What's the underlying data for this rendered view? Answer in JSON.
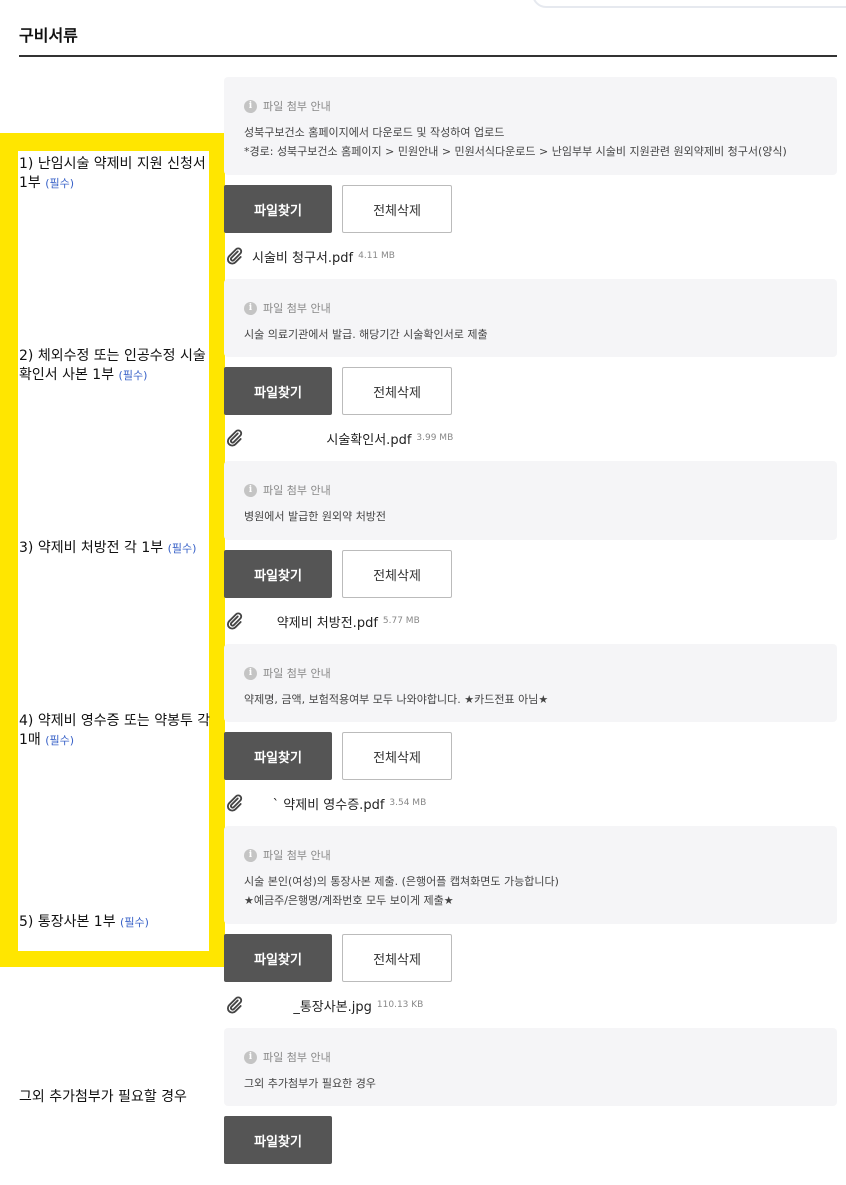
{
  "section_title": "구비서류",
  "info_title": "파일 첨부 안내",
  "find_label": "파일찾기",
  "clear_label": "전체삭제",
  "required": "(필수)",
  "rows": [
    {
      "label": "1) 난임시술 약제비 지원 신청서 1부",
      "info_lines": [
        "성북구보건소 홈페이지에서 다운로드 및 작성하여 업로드",
        "*경로: 성북구보건소 홈페이지 > 민원안내 > 민원서식다운로드 > 난임부부 시술비 지원관련 원외약제비 청구서(양식)"
      ],
      "file_name": "시술비 청구서.pdf",
      "file_size": "4.11 MB"
    },
    {
      "label": "2) 체외수정 또는 인공수정 시술확인서 사본 1부",
      "info_lines": [
        "시술 의료기관에서 발급. 해당기간 시술확인서로 제출"
      ],
      "file_name": "                  시술확인서.pdf",
      "file_size": "3.99 MB"
    },
    {
      "label": "3) 약제비 처방전 각 1부",
      "info_lines": [
        "병원에서 발급한 원외약 처방전"
      ],
      "file_name": "      약제비 처방전.pdf",
      "file_size": "5.77 MB"
    },
    {
      "label": "4) 약제비 영수증 또는 약봉투 각 1매",
      "info_lines": [
        "약제명, 금액, 보험적용여부 모두 나와야합니다. ★카드전표 아님★"
      ],
      "file_name": "     ` 약제비 영수증.pdf",
      "file_size": "3.54 MB"
    },
    {
      "label": "5) 통장사본 1부",
      "info_lines": [
        "시술 본인(여성)의 통장사본 제출. (은행어플 캡쳐화면도 가능합니다)",
        "★예금주/은행명/계좌번호 모두 보이게 제출★"
      ],
      "file_name": "          _통장사본.jpg",
      "file_size": "110.13 KB"
    }
  ],
  "extra": {
    "label": "그외 추가첨부가 필요할 경우",
    "info_lines": [
      "그외 추가첨부가 필요한 경우"
    ]
  }
}
